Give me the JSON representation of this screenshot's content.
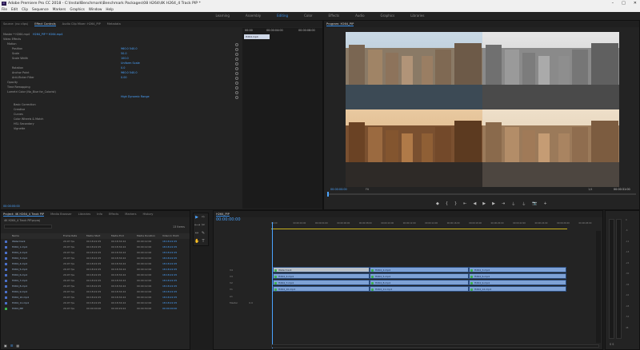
{
  "window": {
    "title": "Adobe Premiere Pro CC 2018 - C:\\InstallBenchmark\\Benchmark Packages\\08 H264\\4K H264_4 Track PIP *",
    "app_icon": "Pr",
    "controls": [
      "–",
      "□",
      "✕"
    ]
  },
  "menu": [
    "File",
    "Edit",
    "Clip",
    "Sequence",
    "Markers",
    "Graphics",
    "Window",
    "Help"
  ],
  "workspaces": {
    "items": [
      "Learning",
      "Assembly",
      "Editing",
      "Color",
      "Effects",
      "Audio",
      "Graphics",
      "Libraries"
    ],
    "active": "Editing"
  },
  "source_panel": {
    "tabs": [
      "Source: (no clips)",
      "Effect Controls",
      "Audio Clip Mixer: H264_PIP",
      "Metadata"
    ],
    "active_tab": "Effect Controls",
    "clip_path": "Master * H264.mp4",
    "clip_sel": "H264_PIP * H264.mp4",
    "timecode_start": "00:00",
    "timecode_mid": "00:00:04:00",
    "timecode_end": "00:00:08:00",
    "clip_label": "H264.mp4",
    "section_video": "Video Effects",
    "fx_rows": [
      {
        "label": "Motion",
        "value": ""
      },
      {
        "label": "Position",
        "value": "960.0     540.0"
      },
      {
        "label": "Scale",
        "value": "50.0"
      },
      {
        "label": "Scale Width",
        "value": "100.0"
      },
      {
        "label": "",
        "value": "Uniform Scale"
      },
      {
        "label": "Rotation",
        "value": "0.0"
      },
      {
        "label": "Anchor Point",
        "value": "960.0     540.0"
      },
      {
        "label": "Anti-flicker Filter",
        "value": "0.00"
      },
      {
        "label": "Opacity",
        "value": ""
      },
      {
        "label": "Time Remapping",
        "value": ""
      },
      {
        "label": "Lumetri Color (No_Blue for_Colorist)",
        "value": ""
      },
      {
        "label": "",
        "value": "High Dynamic Range"
      }
    ],
    "lumetri_sections": [
      "Basic Correction",
      "Creative",
      "Curves",
      "Color Wheels & Match",
      "HSL Secondary",
      "Vignette"
    ],
    "bottom_timecode": "00:00:00:00"
  },
  "program_monitor": {
    "tab": "Program: H264_PIP",
    "timecode": "00:00:00:00",
    "fit": "Fit",
    "fraction": "1/4",
    "duration": "00:00:31:00",
    "buttons": [
      "marker-icon",
      "in-icon",
      "out-icon",
      "go-in-icon",
      "step-back-icon",
      "play-icon",
      "step-forward-icon",
      "go-out-icon",
      "lift-icon",
      "extract-icon",
      "export-frame-icon",
      "add-icon"
    ]
  },
  "project_panel": {
    "tabs": [
      "Project: 4K H264_4 Track PIP",
      "Media Browser",
      "Libraries",
      "Info",
      "Effects",
      "Markers",
      "History"
    ],
    "active_tab": "Project: 4K H264_4 Track PIP",
    "path": "4K H264_4 Track PIP.prproj",
    "count": "13 Items",
    "columns": [
      "Name",
      "Frame Rate",
      "Media Start",
      "Media End",
      "Media Duration",
      "Video In Point"
    ],
    "rows": [
      [
        "Watermark",
        "29.97 fps",
        "00:18:22:25",
        "00:18:34:24",
        "00:00:12:00",
        "18:18:22:25"
      ],
      [
        "H264_1.mp4",
        "29.97 fps",
        "00:18:22:25",
        "00:18:34:24",
        "00:00:12:00",
        "18:18:22:25"
      ],
      [
        "H264_2.mp4",
        "29.97 fps",
        "00:18:22:25",
        "00:18:34:24",
        "00:00:12:00",
        "18:18:22:25"
      ],
      [
        "H264_3.mp4",
        "29.97 fps",
        "00:18:22:25",
        "00:18:34:24",
        "00:00:12:00",
        "18:18:22:25"
      ],
      [
        "H264_4.mp4",
        "29.97 fps",
        "00:18:22:25",
        "00:18:34:24",
        "00:00:12:00",
        "18:18:22:25"
      ],
      [
        "H264_5.mp4",
        "29.97 fps",
        "00:18:22:25",
        "00:18:34:24",
        "00:00:12:00",
        "18:18:22:25"
      ],
      [
        "H264_6.mp4",
        "29.97 fps",
        "00:18:22:25",
        "00:18:34:24",
        "00:00:12:00",
        "18:18:22:25"
      ],
      [
        "H264_7.mp4",
        "29.97 fps",
        "00:18:22:25",
        "00:18:34:24",
        "00:00:12:00",
        "18:18:22:25"
      ],
      [
        "H264_8.mp4",
        "29.97 fps",
        "00:18:22:25",
        "00:18:34:24",
        "00:00:12:00",
        "18:18:22:25"
      ],
      [
        "H264_9.mp4",
        "29.97 fps",
        "00:18:22:25",
        "00:18:34:24",
        "00:00:12:00",
        "18:18:22:25"
      ],
      [
        "H264_10.mp4",
        "29.97 fps",
        "00:18:22:25",
        "00:18:34:24",
        "00:00:12:00",
        "18:18:22:25"
      ],
      [
        "H264_11.mp4",
        "29.97 fps",
        "00:18:22:25",
        "00:18:34:24",
        "00:00:12:00",
        "18:18:22:25"
      ],
      [
        "H264_PIP",
        "29.97 fps",
        "00:00:00:00",
        "00:00:29:24",
        "00:00:30:00",
        "00:00:00:00"
      ]
    ]
  },
  "timeline": {
    "tab": "H264_PIP",
    "timecode": "00:00:00:00",
    "ruler": [
      "00:00",
      "00:00:02:00",
      "00:00:04:00",
      "00:00:06:00",
      "00:00:08:00",
      "00:00:10:00",
      "00:00:12:00",
      "00:00:14:00",
      "00:00:16:00",
      "00:00:18:00",
      "00:00:20:00",
      "00:00:22:00",
      "00:00:24:00",
      "00:00:26:00",
      "00:00:28:00"
    ],
    "tracks": [
      "V4",
      "V3",
      "V2",
      "V1",
      "A1",
      "A2"
    ],
    "master": "Master",
    "master_val": "0.0",
    "clips_v4": [
      "Watermark",
      "H264_2.mp4",
      "H264_3.mp4"
    ],
    "clips_v3": [
      "H264_4.mp4",
      "H264_5.mp4",
      "H264_6.mp4"
    ],
    "clips_v2": [
      "H264_7.mp4",
      "H264_8.mp4",
      "H264_9.mp4"
    ],
    "clips_v1": [
      "H264_10.mp4",
      "H264_11.mp4",
      "H264_12.mp4"
    ]
  },
  "meter": {
    "labels": [
      "0",
      "-6",
      "-12",
      "-18",
      "-24",
      "-30",
      "-36",
      "-42",
      "-48",
      "-54",
      "dB"
    ],
    "sr": "S  S"
  }
}
